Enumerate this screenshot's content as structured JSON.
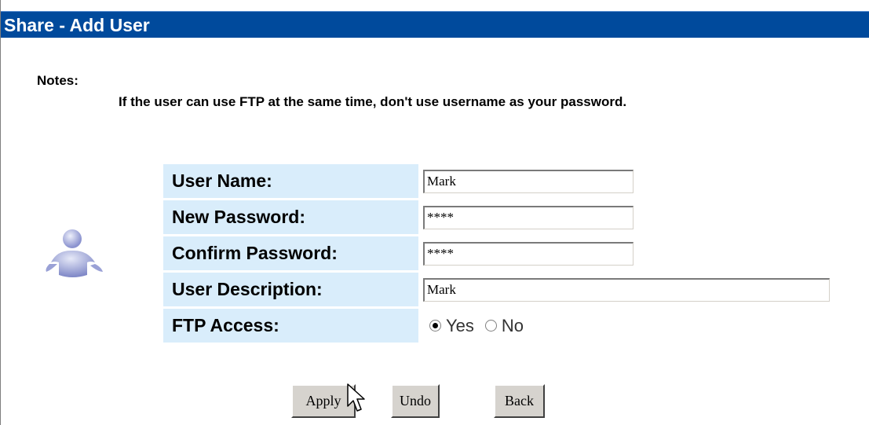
{
  "page": {
    "title": "Share - Add User"
  },
  "notes": {
    "label": "Notes:",
    "text": "If the user can use FTP at the same time, don't use username as your password."
  },
  "form": {
    "user_name": {
      "label": "User Name:",
      "value": "Mark"
    },
    "new_password": {
      "label": "New Password:",
      "value": "****"
    },
    "confirm_password": {
      "label": "Confirm Password:",
      "value": "****"
    },
    "user_description": {
      "label": "User Description:",
      "value": "Mark"
    },
    "ftp_access": {
      "label": "FTP Access:",
      "options": [
        "Yes",
        "No"
      ],
      "selected": "Yes"
    }
  },
  "buttons": {
    "apply": "Apply",
    "undo": "Undo",
    "back": "Back"
  },
  "icons": {
    "avatar": "user-avatar-icon",
    "cursor": "mouse-pointer-icon"
  },
  "colors": {
    "title_bar": "#004a9c",
    "label_background": "#d9edfb"
  }
}
